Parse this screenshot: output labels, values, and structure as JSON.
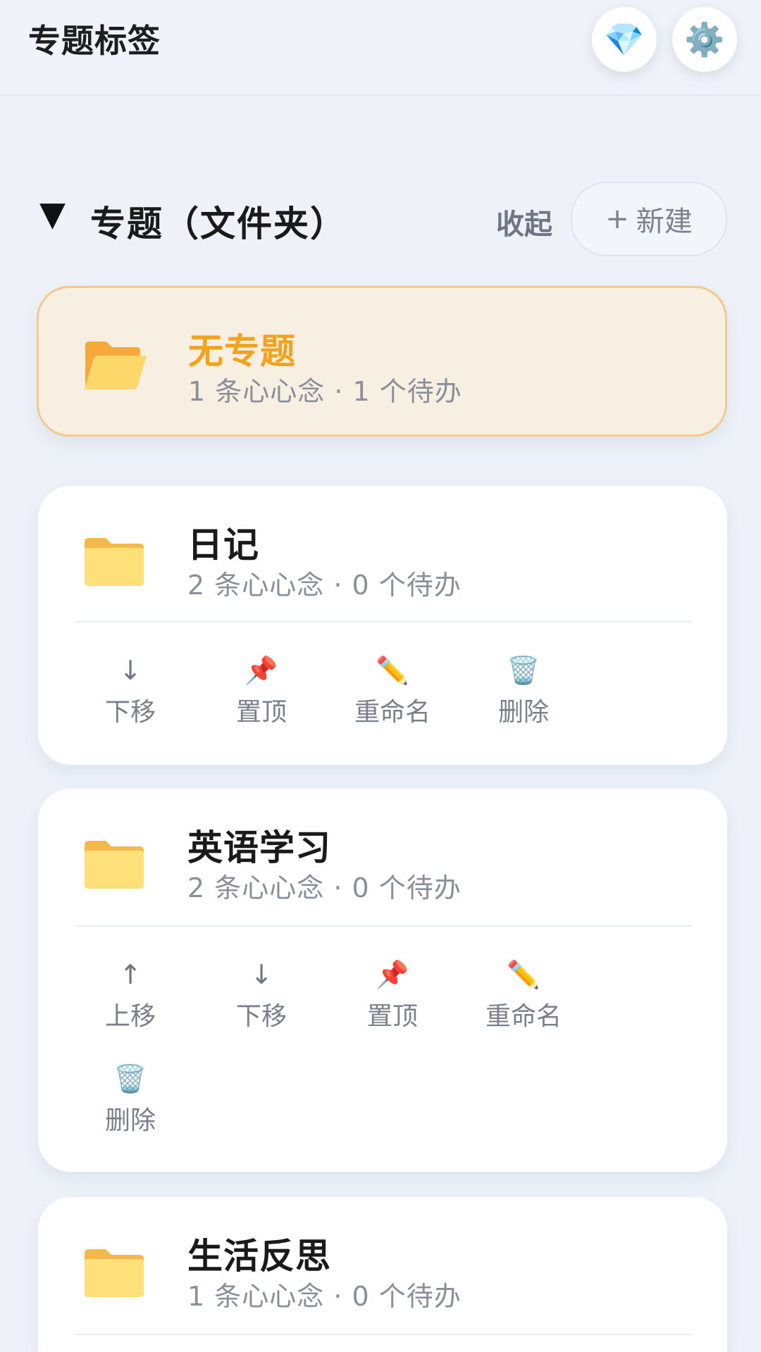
{
  "header": {
    "title": "专题标签",
    "gem_icon": "💎",
    "settings_icon": "⚙️"
  },
  "section": {
    "toggle_icon": "▼",
    "title": "专题（文件夹）",
    "collapse_label": "收起",
    "new_plus": "+",
    "new_label": "新建"
  },
  "cards": [
    {
      "name": "无专题",
      "meta": "1 条心心念 · 1 个待办",
      "actions": []
    },
    {
      "name": "日记",
      "meta": "2 条心心念 · 0 个待办",
      "actions": [
        {
          "icon": "↓",
          "label": "下移"
        },
        {
          "icon": "📌",
          "label": "置顶"
        },
        {
          "icon": "✏️",
          "label": "重命名"
        },
        {
          "icon": "🗑️",
          "label": "删除"
        }
      ]
    },
    {
      "name": "英语学习",
      "meta": "2 条心心念 · 0 个待办",
      "actions": [
        {
          "icon": "↑",
          "label": "上移"
        },
        {
          "icon": "↓",
          "label": "下移"
        },
        {
          "icon": "📌",
          "label": "置顶"
        },
        {
          "icon": "✏️",
          "label": "重命名"
        },
        {
          "icon": "🗑️",
          "label": "删除"
        }
      ]
    },
    {
      "name": "生活反思",
      "meta": "1 条心心念 · 0 个待办",
      "actions": []
    }
  ],
  "colors": {
    "background": "#eef2f8",
    "accent_orange": "#f4a21b",
    "highlight_bg": "#f8efe3",
    "highlight_border": "#f5c98d",
    "folder_yellow": "#fce27a",
    "folder_back": "#f6b84a"
  }
}
